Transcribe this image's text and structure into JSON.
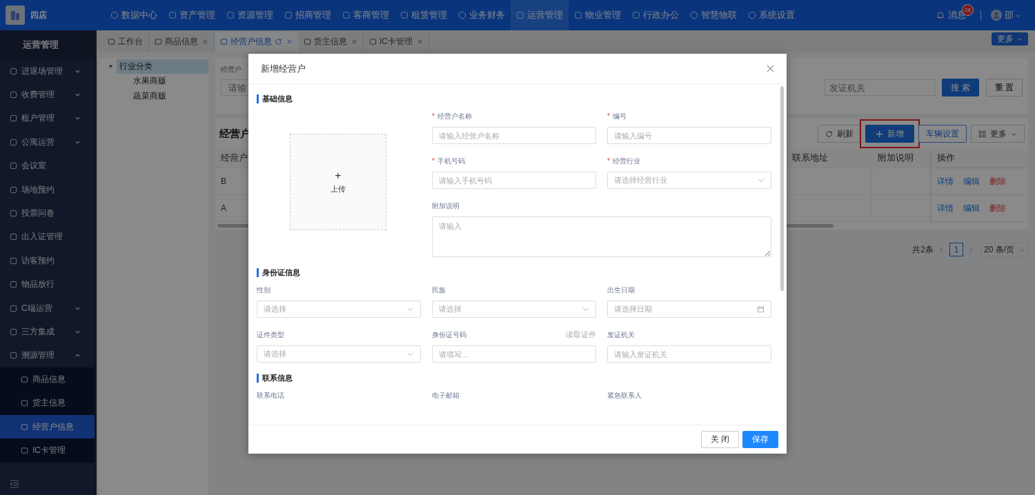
{
  "app": {
    "name": "四店"
  },
  "top_nav": [
    {
      "label": "数据中心",
      "selected": false
    },
    {
      "label": "资产管理",
      "selected": false
    },
    {
      "label": "资源管理",
      "selected": false
    },
    {
      "label": "招商管理",
      "selected": false
    },
    {
      "label": "客商管理",
      "selected": false
    },
    {
      "label": "租赁管理",
      "selected": false
    },
    {
      "label": "业务财务",
      "selected": false
    },
    {
      "label": "运营管理",
      "selected": true
    },
    {
      "label": "物业管理",
      "selected": false
    },
    {
      "label": "行政办公",
      "selected": false
    },
    {
      "label": "智慧物联",
      "selected": false
    },
    {
      "label": "系统设置",
      "selected": false
    }
  ],
  "header_right": {
    "messages": "消息",
    "badge": "28",
    "user": "邵"
  },
  "sidebar": {
    "title": "运营管理",
    "items": [
      {
        "label": "进退场管理",
        "expanded": false,
        "has_children": true
      },
      {
        "label": "收费管理",
        "expanded": false,
        "has_children": true
      },
      {
        "label": "租户管理",
        "expanded": false,
        "has_children": true
      },
      {
        "label": "公寓运营",
        "expanded": false,
        "has_children": true
      },
      {
        "label": "会议室",
        "has_children": false
      },
      {
        "label": "场地预约",
        "has_children": false
      },
      {
        "label": "投票问卷",
        "has_children": false
      },
      {
        "label": "出入证管理",
        "has_children": false
      },
      {
        "label": "访客预约",
        "has_children": false
      },
      {
        "label": "物品放行",
        "has_children": false
      },
      {
        "label": "C端运营",
        "expanded": false,
        "has_children": true
      },
      {
        "label": "三方集成",
        "expanded": false,
        "has_children": true
      },
      {
        "label": "溯源管理",
        "expanded": true,
        "has_children": true,
        "children": [
          {
            "label": "商品信息",
            "selected": false
          },
          {
            "label": "货主信息",
            "selected": false
          },
          {
            "label": "经营户信息",
            "selected": true
          },
          {
            "label": "IC卡管理",
            "selected": false
          }
        ]
      }
    ]
  },
  "tabs": [
    {
      "label": "工作台",
      "selected": false,
      "closable": false
    },
    {
      "label": "商品信息",
      "selected": false,
      "closable": true
    },
    {
      "label": "经营户信息",
      "selected": true,
      "closable": true
    },
    {
      "label": "货主信息",
      "selected": false,
      "closable": true
    },
    {
      "label": "IC卡管理",
      "selected": false,
      "closable": true
    }
  ],
  "tabs_more": "更多",
  "tree": {
    "label": "行业分类",
    "expanded": true,
    "selected": true,
    "children": [
      {
        "label": "水果商贩"
      },
      {
        "label": "蔬菜商贩"
      }
    ]
  },
  "search": {
    "label": "经营户",
    "placeholder": "请输",
    "placeholder_2": "发证机关",
    "buttons": [
      {
        "label": "搜 索",
        "kind": "primary"
      },
      {
        "label": "重 置",
        "kind": "default"
      }
    ]
  },
  "list": {
    "title": "经营户",
    "toolbar": [
      {
        "label": "刷新",
        "kind": "refresh",
        "highlighted": false
      },
      {
        "label": "新增",
        "kind": "add",
        "highlighted": true
      },
      {
        "label": "车辆设置",
        "kind": "outline",
        "highlighted": false
      },
      {
        "label": "更多",
        "kind": "more",
        "highlighted": false
      }
    ],
    "columns": [
      "经营户",
      "联系地址",
      "附加说明",
      "操作"
    ],
    "rows": [
      {
        "name": "B",
        "actions": [
          {
            "label": "详情",
            "kind": "link"
          },
          {
            "label": "编辑",
            "kind": "link"
          },
          {
            "label": "删除",
            "kind": "danger"
          }
        ]
      },
      {
        "name": "A",
        "actions": [
          {
            "label": "详情",
            "kind": "link"
          },
          {
            "label": "编辑",
            "kind": "link"
          },
          {
            "label": "删除",
            "kind": "danger"
          }
        ]
      }
    ],
    "pagination": {
      "total": "共2条",
      "page": "1",
      "page_size": "20 条/页"
    }
  },
  "dialog": {
    "title": "新增经营户",
    "required_mark": "*",
    "upload": "上传",
    "upload_icon": "+",
    "sections": [
      {
        "title": "基础信息",
        "kind": "basic",
        "fields": [
          {
            "label": "经营户名称",
            "required": true,
            "kind": "input",
            "placeholder": "请输入经营户名称"
          },
          {
            "label": "编号",
            "required": true,
            "kind": "input",
            "placeholder": "请输入编号"
          },
          {
            "label": "手机号码",
            "required": true,
            "kind": "input",
            "placeholder": "请输入手机号码"
          },
          {
            "label": "经营行业",
            "required": true,
            "kind": "select",
            "placeholder": "请选择经营行业"
          },
          {
            "label": "附加说明",
            "required": false,
            "kind": "textarea",
            "placeholder": "请输入"
          }
        ]
      },
      {
        "title": "身份证信息",
        "kind": "grid",
        "fields": [
          {
            "label": "性别",
            "required": false,
            "kind": "select",
            "placeholder": "请选择"
          },
          {
            "label": "民族",
            "required": false,
            "kind": "select",
            "placeholder": "请选择"
          },
          {
            "label": "出生日期",
            "required": false,
            "kind": "date",
            "placeholder": "请选择日期"
          },
          {
            "label": "证件类型",
            "required": false,
            "kind": "select",
            "placeholder": "请选择"
          },
          {
            "label": "身份证号码",
            "required": false,
            "kind": "input",
            "placeholder": "请填写...",
            "action": "读取证件"
          },
          {
            "label": "发证机关",
            "required": false,
            "kind": "input",
            "placeholder": "请输入发证机关"
          }
        ]
      },
      {
        "title": "联系信息",
        "kind": "grid",
        "fields": [
          {
            "label": "联系电话",
            "required": false,
            "kind": "label"
          },
          {
            "label": "电子邮箱",
            "required": false,
            "kind": "label"
          },
          {
            "label": "紧急联系人",
            "required": false,
            "kind": "label"
          }
        ]
      }
    ],
    "buttons": [
      {
        "label": "关 闭",
        "kind": "default"
      },
      {
        "label": "保存",
        "kind": "primary"
      }
    ]
  }
}
